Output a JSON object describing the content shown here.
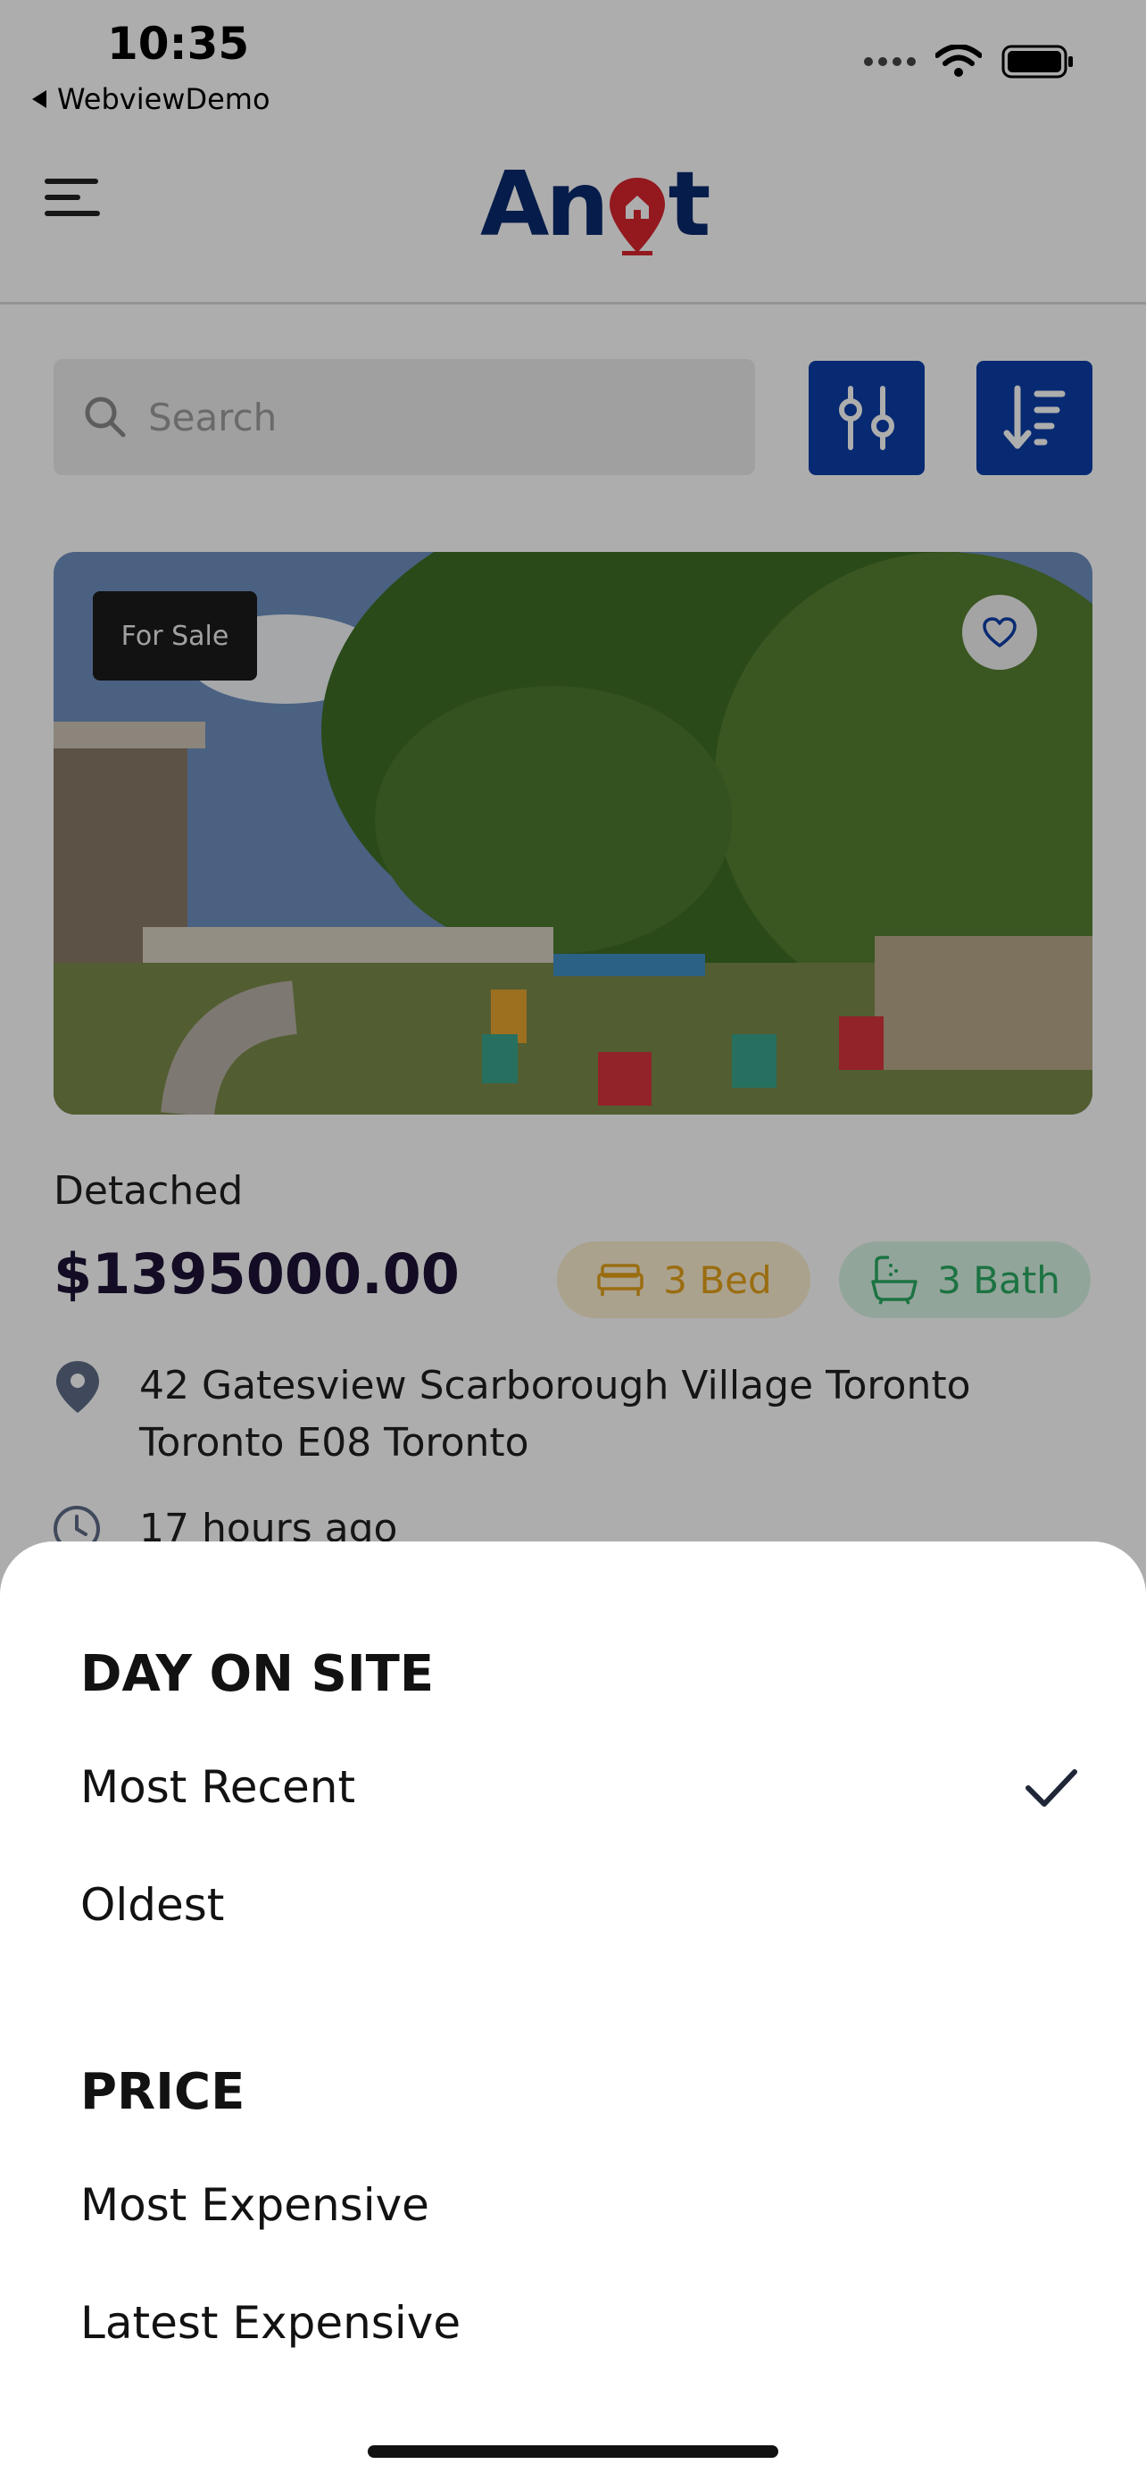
{
  "status_bar": {
    "time": "10:35",
    "back_app": "WebviewDemo"
  },
  "header": {
    "logo_text_left": "An",
    "logo_text_right": "t"
  },
  "search": {
    "placeholder": "Search"
  },
  "listing": {
    "status_badge": "For Sale",
    "type": "Detached",
    "price": "$1395000.00",
    "beds": "3 Bed",
    "baths": "3 Bath",
    "address": "42 Gatesview Scarborough Village Toronto Toronto E08 Toronto",
    "posted": "17 hours ago"
  },
  "sort_sheet": {
    "sections": [
      {
        "title": "DAY ON SITE",
        "options": [
          "Most Recent",
          "Oldest"
        ]
      },
      {
        "title": "PRICE",
        "options": [
          "Most Expensive",
          "Latest Expensive"
        ]
      }
    ],
    "selected": "Most Recent"
  },
  "colors": {
    "brand_blue": "#0d3fa8",
    "logo_red": "#d9252f",
    "bed_chip": "#fcefd0",
    "bath_chip": "#d8f3e3"
  }
}
